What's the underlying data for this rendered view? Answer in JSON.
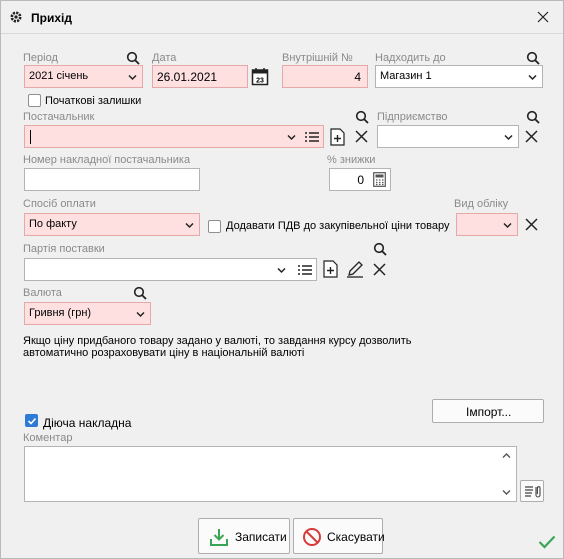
{
  "window": {
    "title": "Прихід"
  },
  "period": {
    "label": "Період",
    "value": "2021 січень"
  },
  "date": {
    "label": "Дата",
    "value": "26.01.2021"
  },
  "internal_no": {
    "label": "Внутрішній №",
    "value": "4"
  },
  "destination": {
    "label": "Надходить до",
    "value": "Магазин 1"
  },
  "opening_balance": {
    "label": "Початкові залишки",
    "checked": false
  },
  "supplier": {
    "label": "Постачальник",
    "value": ""
  },
  "enterprise": {
    "label": "Підприємство",
    "value": ""
  },
  "supplier_invoice": {
    "label": "Номер накладної постачальника",
    "value": ""
  },
  "discount": {
    "label": "% знижки",
    "value": "0"
  },
  "payment": {
    "label": "Спосіб оплати",
    "value": "По факту"
  },
  "vat": {
    "label": "Додавати ПДВ до закупівельної ціни товару",
    "checked": false
  },
  "accounting_type": {
    "label": "Вид обліку",
    "value": ""
  },
  "batch": {
    "label": "Партія поставки",
    "value": ""
  },
  "currency": {
    "label": "Валюта",
    "value": "Гривня (грн)"
  },
  "note": {
    "line1": "Якщо ціну придбаного товару задано у валюті, то завдання курсу дозволить",
    "line2": "автоматично розраховувати ціну в національній валюті"
  },
  "import_button": "Імпорт...",
  "active_invoice": {
    "label": "Діюча накладна",
    "checked": true
  },
  "comment": {
    "label": "Коментар",
    "value": ""
  },
  "buttons": {
    "save": "Записати",
    "cancel": "Скасувати"
  },
  "colors": {
    "accent": "#2e7bd6",
    "required_bg": "#ffe0e0",
    "ok_green": "#3aa655",
    "cancel_red": "#d83a3a"
  }
}
